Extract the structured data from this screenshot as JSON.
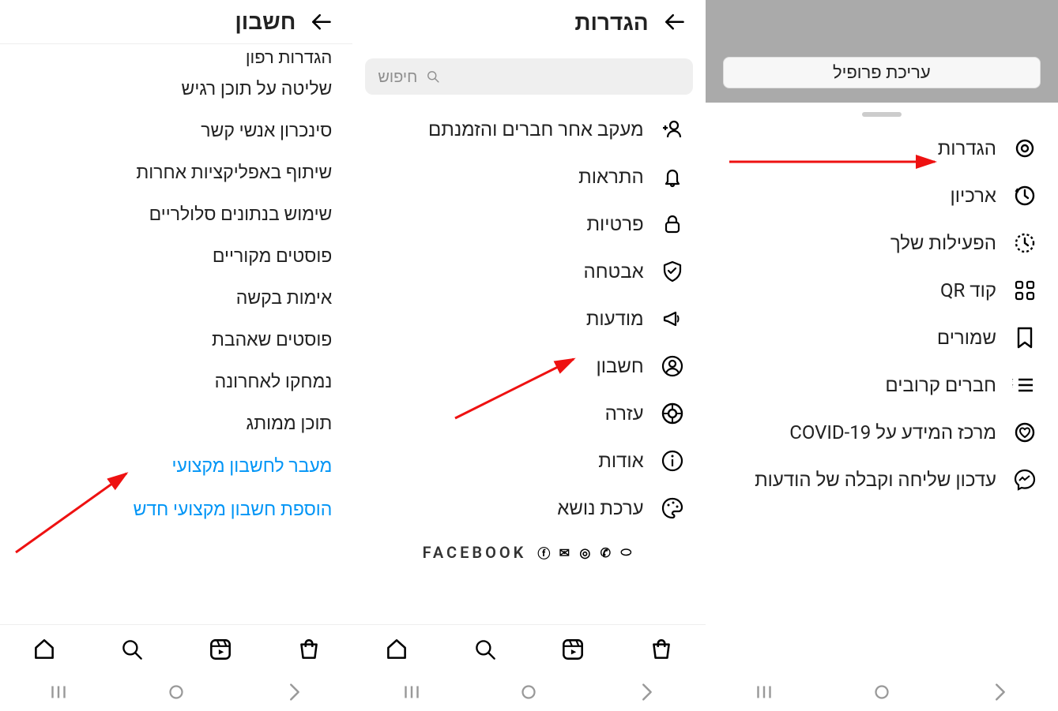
{
  "panel_profile": {
    "edit_profile": "עריכת פרופיל",
    "menu": [
      {
        "label": "הגדרות",
        "icon": "gear"
      },
      {
        "label": "ארכיון",
        "icon": "archive"
      },
      {
        "label": "הפעילות שלך",
        "icon": "activity"
      },
      {
        "label": "קוד QR",
        "icon": "qr"
      },
      {
        "label": "שמורים",
        "icon": "bookmark"
      },
      {
        "label": "חברים קרובים",
        "icon": "closefriends"
      },
      {
        "label": "מרכז המידע על COVID-19",
        "icon": "heart-shield"
      },
      {
        "label": "עדכון שליחה וקבלה של הודעות",
        "icon": "messenger"
      }
    ]
  },
  "panel_settings": {
    "title": "הגדרות",
    "search_placeholder": "חיפוש",
    "items": [
      {
        "label": "מעקב אחר חברים והזמנתם",
        "icon": "add-user"
      },
      {
        "label": "התראות",
        "icon": "bell"
      },
      {
        "label": "פרטיות",
        "icon": "lock"
      },
      {
        "label": "אבטחה",
        "icon": "shield"
      },
      {
        "label": "מודעות",
        "icon": "megaphone"
      },
      {
        "label": "חשבון",
        "icon": "account"
      },
      {
        "label": "עזרה",
        "icon": "help"
      },
      {
        "label": "אודות",
        "icon": "info"
      },
      {
        "label": "ערכת נושא",
        "icon": "palette"
      }
    ],
    "facebook_label": "FACEBOOK"
  },
  "panel_account": {
    "title": "חשבון",
    "items_clipped_first": "הגדרות רפון",
    "items": [
      "שליטה על תוכן רגיש",
      "סינכרון אנשי קשר",
      "שיתוף באפליקציות אחרות",
      "שימוש בנתונים סלולריים",
      "פוסטים מקוריים",
      "אימות בקשה",
      "פוסטים שאהבת",
      "נמחקו לאחרונה",
      "תוכן ממותג"
    ],
    "links": [
      "מעבר לחשבון מקצועי",
      "הוספת חשבון מקצועי חדש"
    ]
  }
}
